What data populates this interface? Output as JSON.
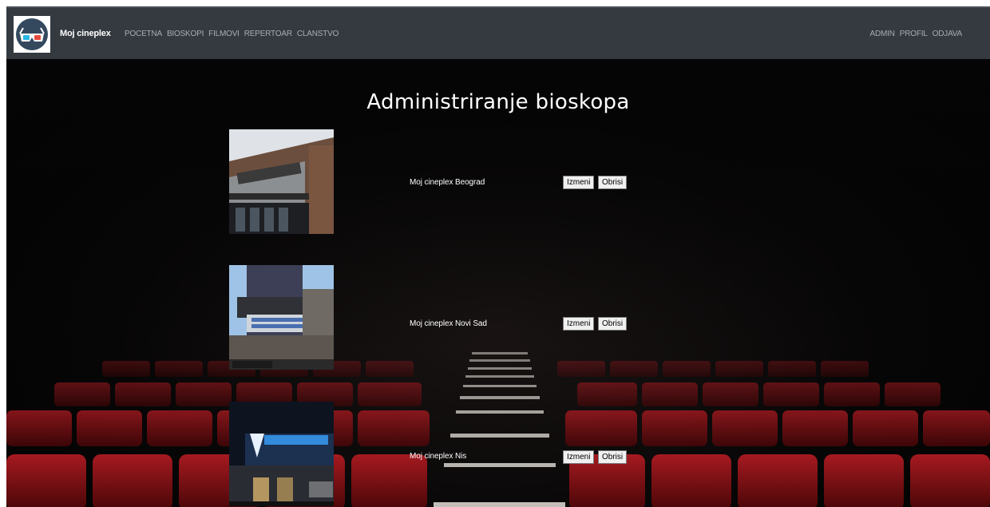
{
  "brand": {
    "name": "Moj cineplex",
    "logo_icon": "3d-glasses-icon"
  },
  "nav": {
    "left": [
      "POCETNA",
      "BIOSKOPI",
      "FILMOVI",
      "REPERTOAR",
      "CLANSTVO"
    ],
    "right": [
      "ADMIN",
      "PROFIL",
      "ODJAVA"
    ]
  },
  "page": {
    "title": "Administriranje bioskopa"
  },
  "cinemas": [
    {
      "name": "Moj cineplex Beograd",
      "image": "cinema-building-imax-photo",
      "edit_label": "Izmeni",
      "delete_label": "Obrisi"
    },
    {
      "name": "Moj cineplex Novi Sad",
      "image": "cinema-marquee-photo",
      "edit_label": "Izmeni",
      "delete_label": "Obrisi"
    },
    {
      "name": "Moj cineplex Nis",
      "image": "cinema-night-sign-photo",
      "edit_label": "Izmeni",
      "delete_label": "Obrisi"
    }
  ],
  "colors": {
    "navbar": "#343a40",
    "nav_link": "#a9adb1",
    "seat_red": "#8e1419",
    "background": "#050505"
  }
}
